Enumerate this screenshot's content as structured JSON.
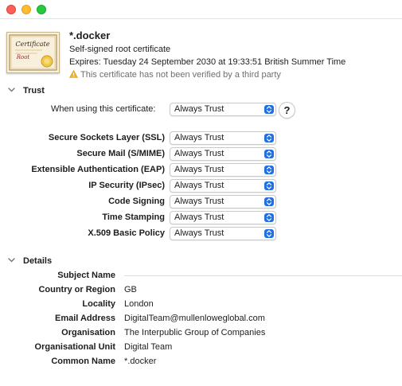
{
  "window": {
    "controls": [
      "close",
      "minimize",
      "maximize"
    ]
  },
  "certificate": {
    "icon_text": "Certificate",
    "icon_subtext": "Root",
    "name": "*.docker",
    "type": "Self-signed root certificate",
    "expires": "Expires: Tuesday 24 September 2030 at 19:33:51 British Summer Time",
    "warning": "This certificate has not been verified by a third party"
  },
  "trust": {
    "title": "Trust",
    "when_using_label": "When using this certificate:",
    "when_using_value": "Always Trust",
    "help": "?",
    "policies": [
      {
        "label": "Secure Sockets Layer (SSL)",
        "value": "Always Trust"
      },
      {
        "label": "Secure Mail (S/MIME)",
        "value": "Always Trust"
      },
      {
        "label": "Extensible Authentication (EAP)",
        "value": "Always Trust"
      },
      {
        "label": "IP Security (IPsec)",
        "value": "Always Trust"
      },
      {
        "label": "Code Signing",
        "value": "Always Trust"
      },
      {
        "label": "Time Stamping",
        "value": "Always Trust"
      },
      {
        "label": "X.509 Basic Policy",
        "value": "Always Trust"
      }
    ]
  },
  "details": {
    "title": "Details",
    "subject_name": "Subject Name",
    "fields": [
      {
        "label": "Country or Region",
        "value": "GB"
      },
      {
        "label": "Locality",
        "value": "London"
      },
      {
        "label": "Email Address",
        "value": "DigitalTeam@mullenloweglobal.com"
      },
      {
        "label": "Organisation",
        "value": "The Interpublic Group of Companies"
      },
      {
        "label": "Organisational Unit",
        "value": "Digital Team"
      },
      {
        "label": "Common Name",
        "value": "*.docker"
      }
    ]
  }
}
